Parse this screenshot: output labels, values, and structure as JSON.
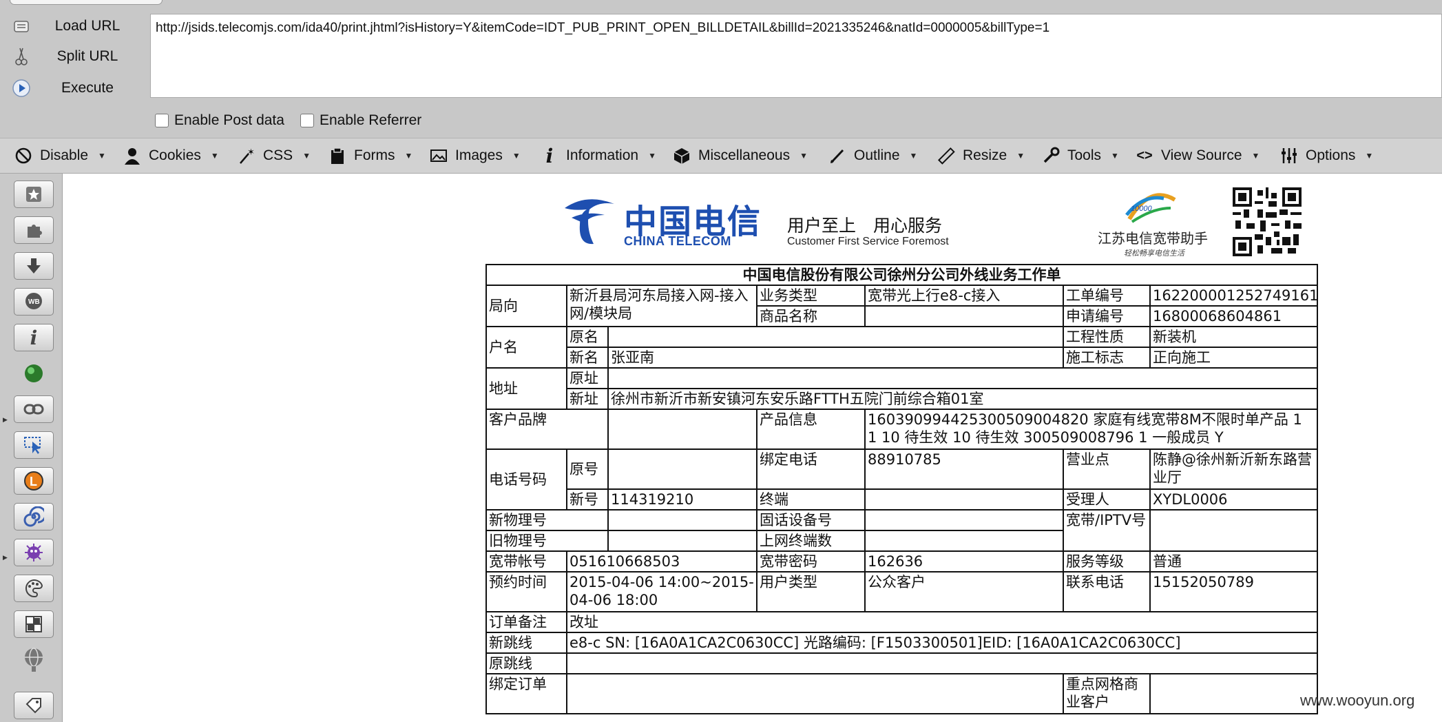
{
  "hackbar": {
    "buttons": [
      {
        "label": "Load URL",
        "icon": "load-url-icon"
      },
      {
        "label": "Split URL",
        "icon": "scissors-icon"
      },
      {
        "label": "Execute",
        "icon": "play-icon"
      }
    ],
    "url_value": "http://jsids.telecomjs.com/ida40/print.jhtml?isHistory=Y&itemCode=IDT_PUB_PRINT_OPEN_BILLDETAIL&billId=2021335246&natId=0000005&billType=1",
    "enable_post": "Enable Post data",
    "enable_referrer": "Enable Referrer"
  },
  "toolbar": {
    "items": [
      {
        "label": "Disable",
        "icon": "disable-icon"
      },
      {
        "label": "Cookies",
        "icon": "user-icon"
      },
      {
        "label": "CSS",
        "icon": "wand-icon"
      },
      {
        "label": "Forms",
        "icon": "clipboard-icon"
      },
      {
        "label": "Images",
        "icon": "image-icon"
      },
      {
        "label": "Information",
        "icon": "info-icon"
      },
      {
        "label": "Miscellaneous",
        "icon": "cube-icon"
      },
      {
        "label": "Outline",
        "icon": "pencil-icon"
      },
      {
        "label": "Resize",
        "icon": "ruler-icon"
      },
      {
        "label": "Tools",
        "icon": "wrench-icon"
      },
      {
        "label": "View Source",
        "icon": "code-icon"
      },
      {
        "label": "Options",
        "icon": "sliders-icon"
      }
    ]
  },
  "sidebar": {
    "icons": [
      "bookmark-star-icon",
      "puzzle-icon",
      "download-arrow-icon",
      "wot-icon",
      "info-icon",
      "green-orb-icon",
      "chain-link-icon",
      "cursor-select-icon",
      "orange-l-icon",
      "spiral-icon",
      "purple-bug-icon",
      "palette-icon",
      "grid-icon",
      "globe-icon",
      "tag-icon"
    ]
  },
  "document": {
    "logo_cn": "中国电信",
    "logo_en": "CHINA TELECOM",
    "slogan_cn": "用户至上　用心服务",
    "slogan_en": "Customer First Service Foremost",
    "helper_logo": "10000",
    "helper_text": "江苏电信宽带助手",
    "helper_sub": "轻松畅享电信生活",
    "table": {
      "title": "中国电信股份有限公司徐州分公司外线业务工作单",
      "bureau_label": "局向",
      "bureau_value": "新沂县局河东局接入网-接入网/模块局",
      "biz_type_label": "业务类型",
      "biz_type_value": "宽带光上行e8-c接入",
      "work_no_label": "工单编号",
      "work_no_value": "162200001252749161",
      "goods_label": "商品名称",
      "goods_value": "",
      "apply_no_label": "申请编号",
      "apply_no_value": "16800068604861",
      "account_label": "户名",
      "orig_name_label": "原名",
      "orig_name_value": "",
      "new_name_label": "新名",
      "new_name_value": "张亚南",
      "project_label": "工程性质",
      "project_value": "新装机",
      "construct_label": "施工标志",
      "construct_value": "正向施工",
      "address_label": "地址",
      "orig_addr_label": "原址",
      "orig_addr_value": "",
      "new_addr_label": "新址",
      "new_addr_value": "徐州市新沂市新安镇河东安乐路FTTH五院门前综合箱01室",
      "brand_label": "客户品牌",
      "brand_value": "",
      "product_label": "产品信息",
      "product_value": "16039099442530050900482​0 家庭有线宽带8M不限时单产品 1 1 10 待生效 10 待生效 300509008796 1 一般成员 Y",
      "phone_label": "电话号码",
      "orig_no_label": "原号",
      "orig_no_value": "",
      "bind_phone_label": "绑定电话",
      "bind_phone_value": "88910785",
      "branch_label": "营业点",
      "branch_value": "陈静@徐州新沂新东路营业厅",
      "new_no_label": "新号",
      "new_no_value": "114319210",
      "terminal_label": "终端",
      "terminal_value": "",
      "handler_label": "受理人",
      "handler_value": "XYDL0006",
      "new_phys_label": "新物理号",
      "new_phys_value": "",
      "fixed_device_label": "固话设备号",
      "fixed_device_value": "",
      "bb_iptv_label": "宽带/IPTV号",
      "bb_iptv_value": "",
      "old_phys_label": "旧物理号",
      "old_phys_value": "",
      "online_terms_label": "上网终端数",
      "online_terms_value": "",
      "bb_account_label": "宽带帐号",
      "bb_account_value": "051610668503",
      "bb_pwd_label": "宽带密码",
      "bb_pwd_value": "162636",
      "service_level_label": "服务等级",
      "service_level_value": "普通",
      "appt_label": "预约时间",
      "appt_value": "2015-04-06 14:00~2015-04-06 18:00",
      "user_type_label": "用户类型",
      "user_type_value": "公众客户",
      "contact_label": "联系电话",
      "contact_value": "15152050789",
      "remark_label": "订单备注",
      "remark_value": "改址",
      "new_jumper_label": "新跳线",
      "new_jumper_value": "e8-c SN: [16A0A1CA2C0630CC] 光路编码: [F1503300501]EID: [16A0A1CA2C0630CC]",
      "old_jumper_label": "原跳线",
      "old_jumper_value": "",
      "bind_order_label": "绑定订单",
      "bind_order_value": "",
      "key_grid_label": "重点网格商业客户",
      "key_grid_value": ""
    }
  },
  "watermark": "www.wooyun.org",
  "colors": {
    "telecom_blue": "#1e4fb0",
    "toolbar_gray": "#d2d2d2",
    "hackbar_gray": "#c8c8c8"
  }
}
